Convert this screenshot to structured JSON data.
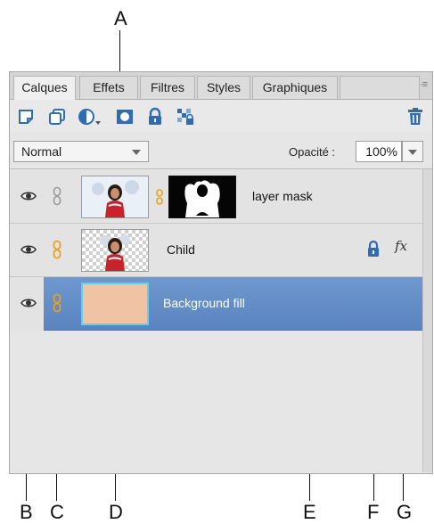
{
  "callouts": [
    "A",
    "B",
    "C",
    "D",
    "E",
    "F",
    "G"
  ],
  "tabs": [
    "Calques",
    "Effets",
    "Filtres",
    "Styles",
    "Graphiques"
  ],
  "active_tab": "Calques",
  "panel_menu": "·≡",
  "toolbar_icons": [
    "new-layer-icon",
    "new-group-icon",
    "adjustment-layer-icon",
    "add-mask-icon",
    "lock-all-icon",
    "lock-transparency-icon",
    "trash-icon"
  ],
  "blend": {
    "mode": "Normal",
    "options": [
      "Normal"
    ]
  },
  "opacity": {
    "label": "Opacité :",
    "value": "100%"
  },
  "layers": [
    {
      "name": "layer mask",
      "visible": true,
      "linked": false,
      "has_mask": true,
      "locked": false,
      "fx": false,
      "selected": false
    },
    {
      "name": "Child",
      "visible": true,
      "linked": true,
      "has_mask": false,
      "locked": true,
      "fx": true,
      "selected": false
    },
    {
      "name": "Background fill",
      "visible": true,
      "linked": true,
      "has_mask": false,
      "locked": false,
      "fx": false,
      "selected": true
    }
  ],
  "fx_label": "fx",
  "colors": {
    "panel_bg": "#e6e6e6",
    "selected_row": "#6790c9",
    "accent_blue": "#2f6cb3",
    "link_orange": "#e8a020",
    "fill_color": "#f0c3a5"
  }
}
